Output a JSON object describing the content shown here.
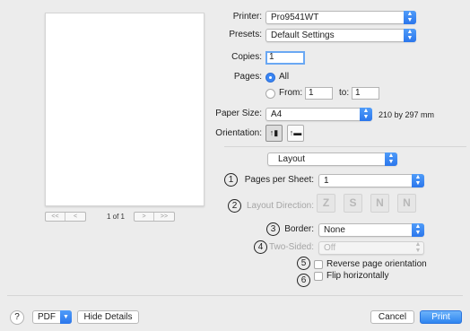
{
  "preview": {
    "nav_first": "<<",
    "nav_prev": "<",
    "page_count": "1 of 1",
    "nav_next": ">",
    "nav_last": ">>"
  },
  "printer": {
    "label": "Printer:",
    "value": "Pro9541WT"
  },
  "presets": {
    "label": "Presets:",
    "value": "Default Settings"
  },
  "copies": {
    "label": "Copies:",
    "value": "1"
  },
  "pages": {
    "label": "Pages:",
    "all_label": "All",
    "from_label": "From:",
    "from_value": "1",
    "to_label": "to:",
    "to_value": "1"
  },
  "paper_size": {
    "label": "Paper Size:",
    "value": "A4",
    "dimensions": "210 by 297 mm"
  },
  "orientation": {
    "label": "Orientation:"
  },
  "section_popup": {
    "value": "Layout"
  },
  "layout": {
    "pages_per_sheet": {
      "number": "1",
      "label": "Pages per Sheet:",
      "value": "1"
    },
    "layout_direction": {
      "number": "2",
      "label": "Layout Direction:",
      "options": [
        "Z",
        "S",
        "N",
        "N"
      ]
    },
    "border": {
      "number": "3",
      "label": "Border:",
      "value": "None"
    },
    "two_sided": {
      "number": "4",
      "label": "Two-Sided:",
      "value": "Off"
    },
    "reverse": {
      "number": "5",
      "label": "Reverse page orientation"
    },
    "flip": {
      "number": "6",
      "label": "Flip horizontally"
    }
  },
  "footer": {
    "help": "?",
    "pdf": "PDF",
    "hide_details": "Hide Details",
    "cancel": "Cancel",
    "print": "Print"
  },
  "colors": {
    "accent": "#2f85f0",
    "stepper": "#3a85f3"
  }
}
